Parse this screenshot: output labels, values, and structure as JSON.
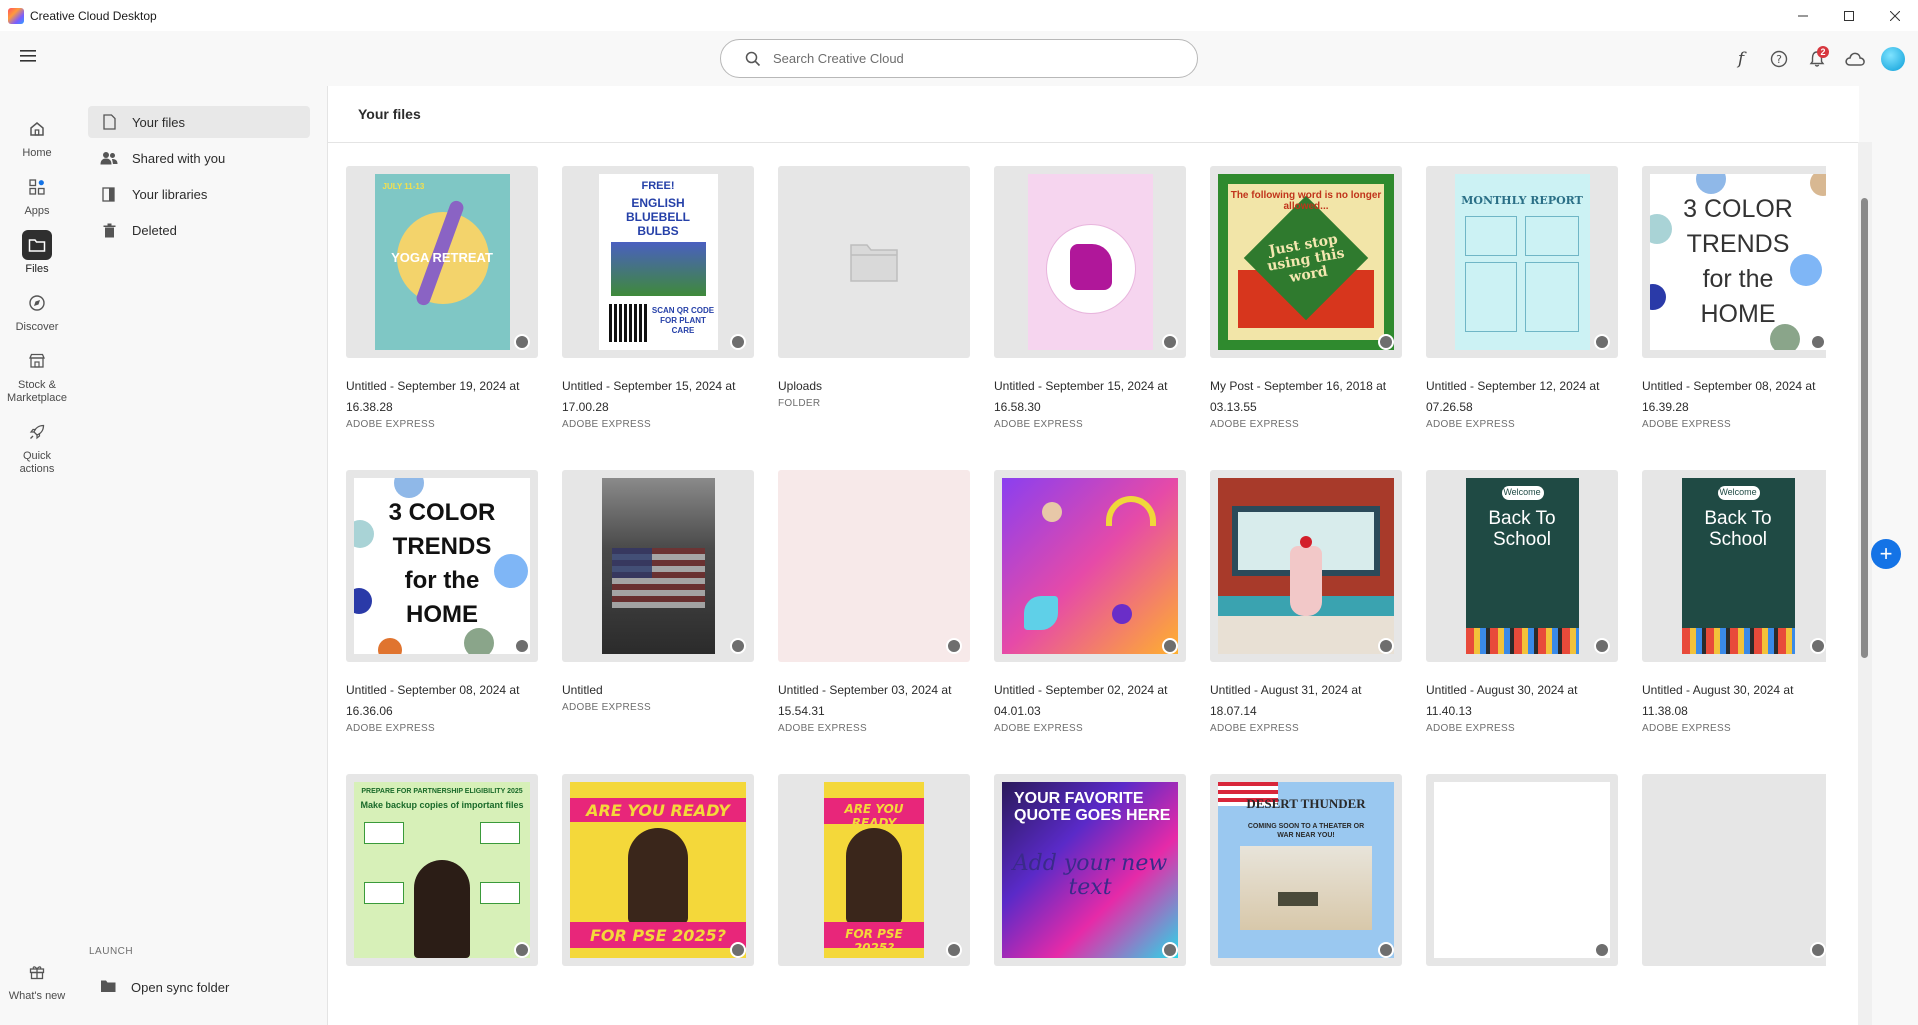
{
  "window": {
    "title": "Creative Cloud Desktop"
  },
  "search": {
    "placeholder": "Search Creative Cloud"
  },
  "header": {
    "notification_count": "2"
  },
  "rail": {
    "home": "Home",
    "apps": "Apps",
    "files": "Files",
    "discover": "Discover",
    "stock": "Stock & Marketplace",
    "quick": "Quick actions",
    "whats_new": "What's new"
  },
  "subnav": {
    "your_files": "Your files",
    "shared": "Shared with you",
    "libraries": "Your libraries",
    "deleted": "Deleted",
    "launch": "LAUNCH",
    "sync": "Open sync folder"
  },
  "main": {
    "title": "Your files"
  },
  "files": [
    {
      "name": "Untitled - September 19, 2024 at 16.38.28",
      "type": "ADOBE EXPRESS"
    },
    {
      "name": "Untitled - September 15, 2024 at 17.00.28",
      "type": "ADOBE EXPRESS"
    },
    {
      "name": "Uploads",
      "type": "FOLDER"
    },
    {
      "name": "Untitled - September 15, 2024 at 16.58.30",
      "type": "ADOBE EXPRESS"
    },
    {
      "name": "My Post - September 16, 2018 at 03.13.55",
      "type": "ADOBE EXPRESS"
    },
    {
      "name": "Untitled - September 12, 2024 at 07.26.58",
      "type": "ADOBE EXPRESS"
    },
    {
      "name": "Untitled - September 08, 2024 at 16.39.28",
      "type": "ADOBE EXPRESS"
    },
    {
      "name": "Untitled - September 08, 2024 at 16.36.06",
      "type": "ADOBE EXPRESS"
    },
    {
      "name": "Untitled",
      "type": "ADOBE EXPRESS"
    },
    {
      "name": "Untitled - September 03, 2024 at 15.54.31",
      "type": "ADOBE EXPRESS"
    },
    {
      "name": "Untitled - September 02, 2024 at 04.01.03",
      "type": "ADOBE EXPRESS"
    },
    {
      "name": "Untitled - August 31, 2024 at 18.07.14",
      "type": "ADOBE EXPRESS"
    },
    {
      "name": "Untitled - August 30, 2024 at 11.40.13",
      "type": "ADOBE EXPRESS"
    },
    {
      "name": "Untitled - August 30, 2024 at 11.38.08",
      "type": "ADOBE EXPRESS"
    }
  ],
  "thumb_text": {
    "bluebell": {
      "free": "FREE!",
      "title": "ENGLISH BLUEBELL BULBS",
      "scan": "SCAN QR CODE FOR PLANT CARE"
    },
    "yoga": {
      "date": "JULY 11-13",
      "word": "YOGA RETREAT"
    },
    "word": {
      "top": "The following word is no longer allowed...",
      "big": "Just stop using this word"
    },
    "report": {
      "title": "MONTHLY REPORT"
    },
    "trends": {
      "line1": "3 COLOR",
      "line2": "TRENDS",
      "line3": "for the",
      "line4": "HOME"
    },
    "school": {
      "welcome": "Welcome",
      "line1": "Back To",
      "line2": "School"
    },
    "ready": {
      "top": "ARE YOU READY",
      "bottom": "FOR PSE 2025?"
    },
    "quote": {
      "text": "YOUR FAVORITE QUOTE GOES HERE",
      "overlay": "Add your new text"
    },
    "desert": {
      "title": "DESERT THUNDER",
      "sub": "COMING SOON TO A THEATER OR WAR NEAR YOU!"
    },
    "prepare": {
      "top": "PREPARE FOR PARTNERSHIP ELIGIBILITY 2025",
      "sub": "Make backup copies of important files"
    }
  },
  "colors": {
    "accent": "#1473e6",
    "badge": "#d7373f"
  }
}
